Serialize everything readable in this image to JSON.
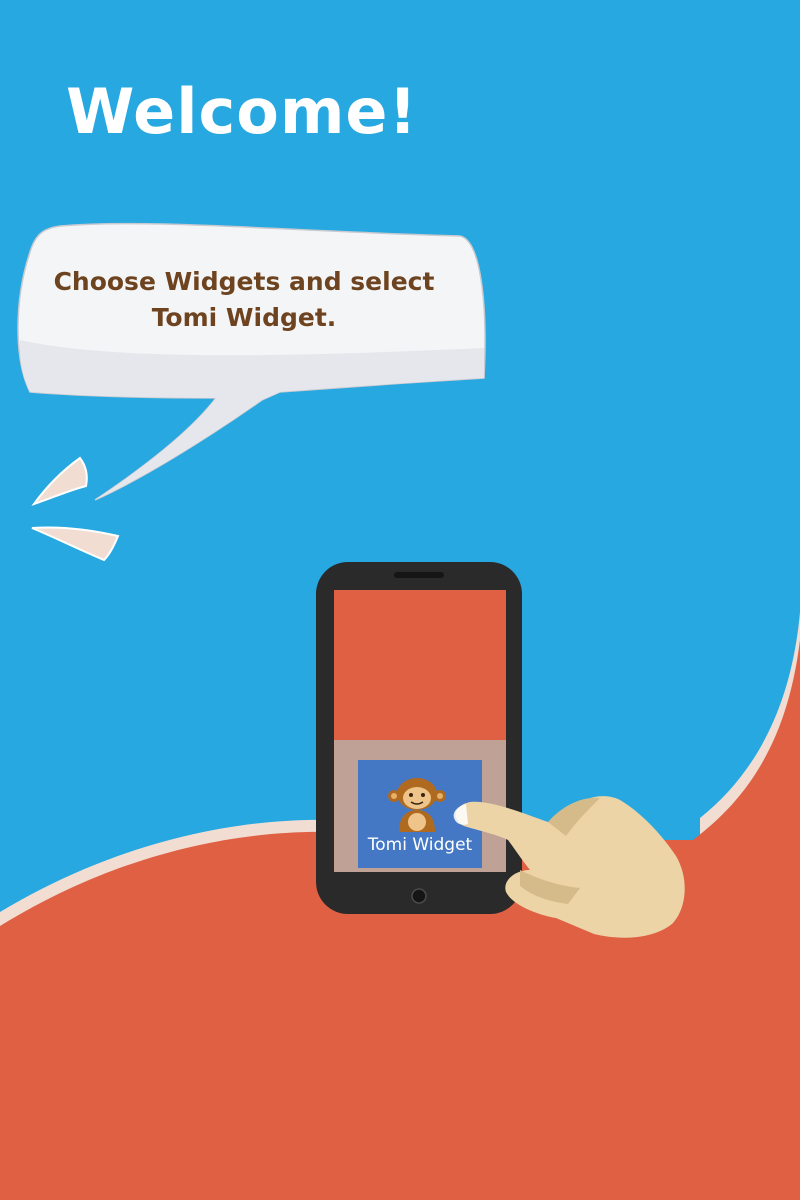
{
  "screen": {
    "title": "Welcome!",
    "instruction_line1": "Choose Widgets and select",
    "instruction_line2": "Tomi Widget."
  },
  "widget": {
    "label": "Tomi Widget",
    "icon": "monkey-icon"
  },
  "colors": {
    "background_blue": "#27a8e0",
    "background_orange": "#e06044",
    "phone_body": "#2a2a2a",
    "phone_screen": "#e06044",
    "widget_tile": "#4477c4",
    "bubble": "#f4f5f7",
    "instruction_text": "#6e4420",
    "skin": "#ecd4a6"
  }
}
